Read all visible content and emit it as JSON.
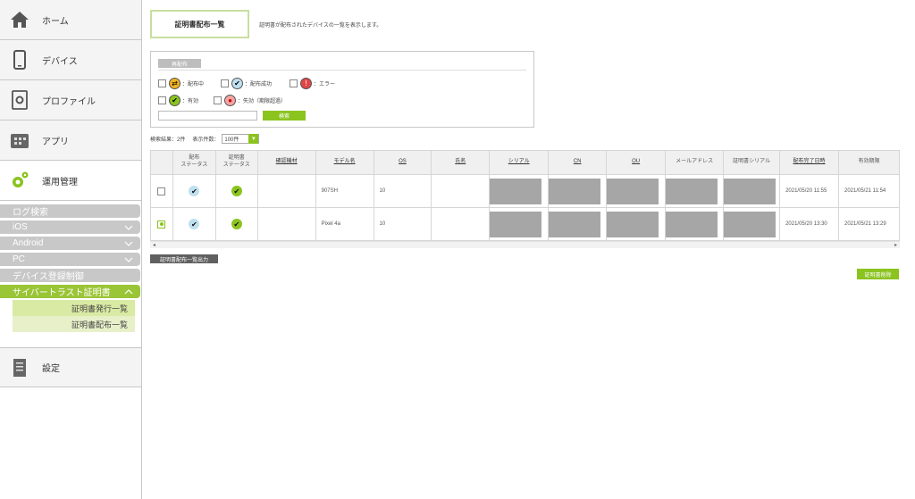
{
  "sidebar": {
    "home": "ホーム",
    "device": "デバイス",
    "profile": "プロファイル",
    "app": "アプリ",
    "operations": "運用管理",
    "sub": {
      "log_search": "ログ検索",
      "ios": "iOS",
      "android": "Android",
      "pc": "PC",
      "device_reg": "デバイス登録制御",
      "cybertrust": "サイバートラスト証明書",
      "cert_issue_list": "証明書発行一覧",
      "cert_dist_list": "証明書配布一覧"
    },
    "settings": "設定"
  },
  "header": {
    "tab_label": "証明書配布一覧",
    "description": "証明書が配布されたデバイスの一覧を表示します。"
  },
  "filter": {
    "tab": "再配布",
    "options": {
      "distributing": "：配布中",
      "dist_success": "：配布成功",
      "error": "：エラー",
      "valid": "：有効",
      "failed": "：失効（期限超過）"
    },
    "search_button": "検索"
  },
  "results": {
    "count_label": "検索結果：2件",
    "per_page_label": "表示件数：",
    "per_page_value": "100件"
  },
  "table": {
    "headers": [
      "",
      "配布\nステータス",
      "証明書\nステータス",
      "確認機材",
      "モデル名",
      "OS",
      "氏名",
      "シリアル",
      "CN",
      "OU",
      "メールアドレス",
      "証明書シリアル",
      "配布完了日時",
      "有効期限"
    ],
    "rows": [
      {
        "model": "907SH",
        "os": "10",
        "done": "2021/05/20 11:55",
        "expire": "2021/05/21 11:54"
      },
      {
        "model": "Pixel 4a",
        "os": "10",
        "done": "2021/05/20 13:30",
        "expire": "2021/05/21 13:29"
      }
    ]
  },
  "buttons": {
    "export": "証明書配布一覧出力",
    "delete": "証明書削除"
  }
}
